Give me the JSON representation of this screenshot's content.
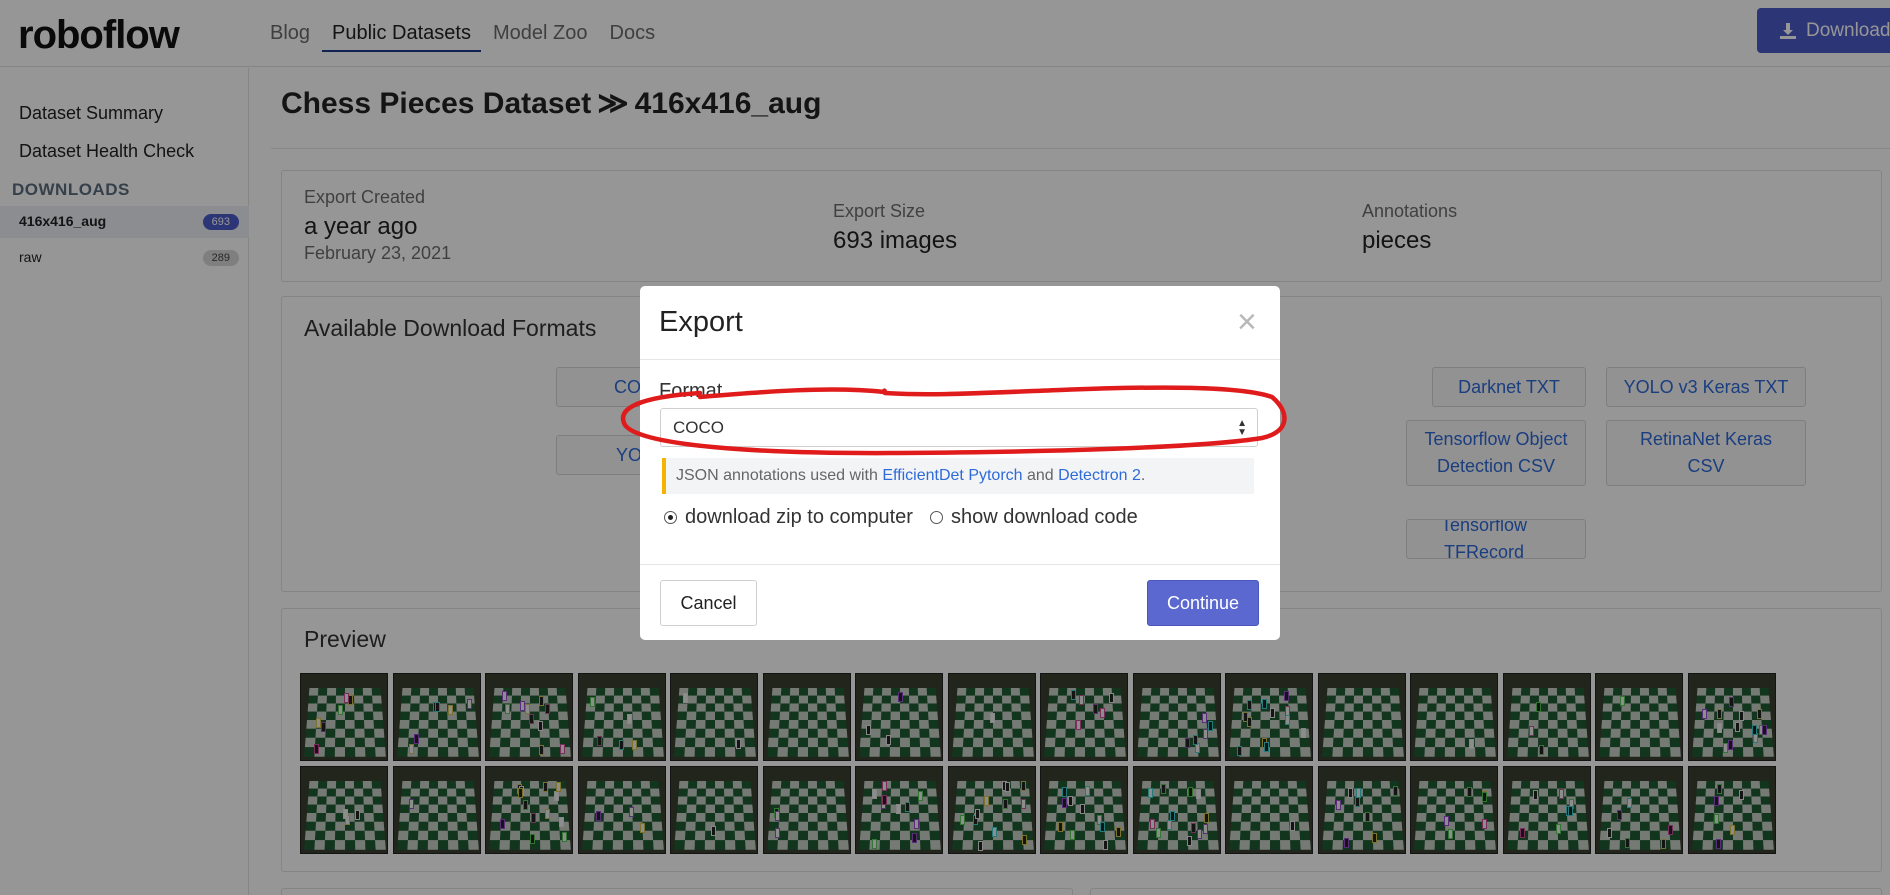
{
  "app": {
    "logo": "roboflow",
    "nav": [
      "Blog",
      "Public Datasets",
      "Model Zoo",
      "Docs"
    ],
    "active_nav": "Public Datasets",
    "download_label": "Download"
  },
  "sidebar": {
    "links": [
      "Dataset Summary",
      "Dataset Health Check"
    ],
    "downloads_heading": "DOWNLOADS",
    "versions": [
      {
        "name": "416x416_aug",
        "count": "693"
      },
      {
        "name": "raw",
        "count": "289"
      }
    ]
  },
  "page": {
    "dataset": "Chess Pieces Dataset",
    "separator": "≫",
    "version": "416x416_aug"
  },
  "export_info": {
    "created_label": "Export Created",
    "created_value": "a year ago",
    "created_date": "February 23, 2021",
    "size_label": "Export Size",
    "size_value": "693 images",
    "annotations_label": "Annotations",
    "annotations_value": "pieces"
  },
  "formats": {
    "title": "Available Download Formats",
    "buttons": {
      "coco": "COCO",
      "yolo": "YOLO",
      "darknet": "Darknet TXT",
      "yolo_keras": "YOLO v3 Keras TXT",
      "tf_csv": "Tensorflow Object Detection CSV",
      "retinanet": "RetinaNet Keras CSV",
      "tfrecord": "Tensorflow TFRecord"
    }
  },
  "preview": {
    "title": "Preview"
  },
  "modal": {
    "title": "Export",
    "close": "×",
    "format_label": "Format",
    "format_value": "COCO",
    "hint_text": "JSON annotations used with ",
    "hint_link1": "EfficientDet Pytorch",
    "hint_and": " and ",
    "hint_link2": "Detectron 2",
    "hint_end": ".",
    "option_zip": "download zip to computer",
    "option_code": "show download code",
    "selected_option": "download zip to computer",
    "cancel": "Cancel",
    "continue": "Continue"
  },
  "colors": {
    "accent": "#4b5ac8",
    "link": "#2f6ad9",
    "annotation_circle": "#e01b1b",
    "hint_border": "#f4b400"
  }
}
